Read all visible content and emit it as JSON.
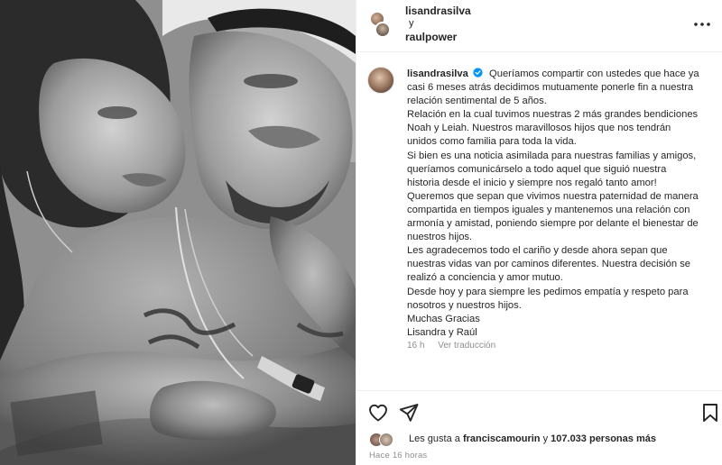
{
  "header": {
    "user1": "lisandrasilva",
    "conjunction": "y",
    "user2": "raulpower"
  },
  "caption": {
    "username": "lisandrasilva",
    "first_line": "Queríamos compartir con ustedes que hace ya",
    "lines": [
      "casi 6 meses atrás decidimos mutuamente ponerle fin a nuestra",
      "relación sentimental de 5 años.",
      "Relación en la cual tuvimos nuestras 2 más grandes bendiciones",
      "Noah y Leiah. Nuestros maravillosos hijos que nos tendrán",
      "unidos como familia para toda la vida.",
      "Si bien es una noticia asimilada para nuestras familias y amigos,",
      "queríamos comunicárselo a todo aquel que siguió nuestra",
      "historia desde el inicio y siempre nos regaló tanto amor!",
      "Queremos que sepan que vivimos nuestra paternidad de manera",
      "compartida en tiempos iguales y mantenemos una relación con",
      "armonía y amistad, poniendo siempre por delante el bienestar de",
      "nuestros hijos.",
      "Les agradecemos todo el cariño y desde ahora sepan que",
      "nuestras vidas van por caminos diferentes. Nuestra decisión se",
      "realizó a conciencia y amor mutuo.",
      "Desde hoy y para siempre les pedimos empatía y respeto para",
      "nosotros y nuestros hijos.",
      "Muchas Gracias",
      "Lisandra y Raúl"
    ],
    "time": "16 h",
    "translate": "Ver traducción"
  },
  "likes": {
    "prefix": "Les gusta a",
    "liker": "franciscamourin",
    "connector": "y",
    "count": "107.033 personas más"
  },
  "posted_ago": "Hace 16 horas",
  "icons": {
    "more": "more-options-icon",
    "like": "heart-icon",
    "share": "share-icon",
    "save": "bookmark-icon",
    "verified": "verified-badge-icon"
  },
  "colors": {
    "verified": "#0095f6",
    "text": "#262626",
    "secondary": "#8e8e8e"
  }
}
